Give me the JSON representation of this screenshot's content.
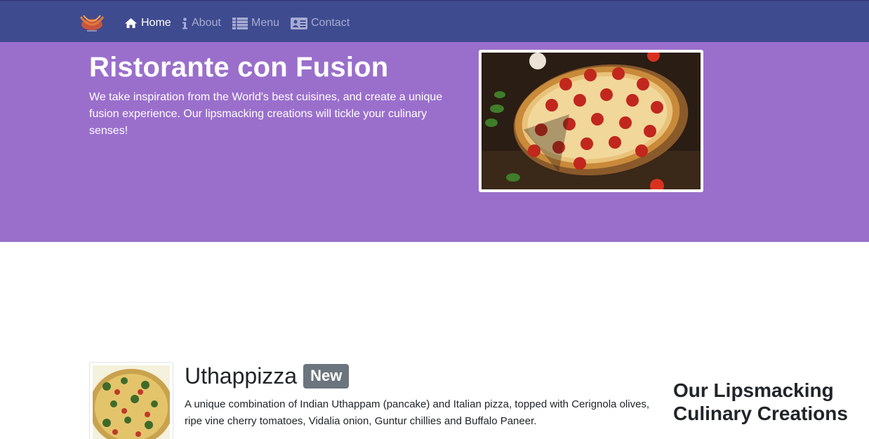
{
  "nav": {
    "logo_icon": "restaurant-logo",
    "items": [
      {
        "label": "Home",
        "icon": "home-icon",
        "active": true
      },
      {
        "label": "About",
        "icon": "info-icon",
        "active": false
      },
      {
        "label": "Menu",
        "icon": "list-icon",
        "active": false
      },
      {
        "label": "Contact",
        "icon": "address-card-icon",
        "active": false
      }
    ]
  },
  "hero": {
    "title": "Ristorante con Fusion",
    "description": "We take inspiration from the World's best cuisines, and create a unique fusion experience. Our lipsmacking creations will tickle your culinary senses!",
    "image_icon": "pizza-image"
  },
  "featured": {
    "name": "Uthappizza",
    "badge": "New",
    "description": "A unique combination of Indian Uthappam (pancake) and Italian pizza, topped with Cerignola olives, ripe vine cherry tomatoes, Vidalia onion, Guntur chillies and Buffalo Paneer.",
    "image_icon": "uthappizza-image"
  },
  "sidebar": {
    "heading": "Our Lipsmacking Culinary Creations"
  },
  "colors": {
    "navbar": "#3f4b8f",
    "jumbotron": "#9a6fcc",
    "badge": "#6c757d"
  }
}
